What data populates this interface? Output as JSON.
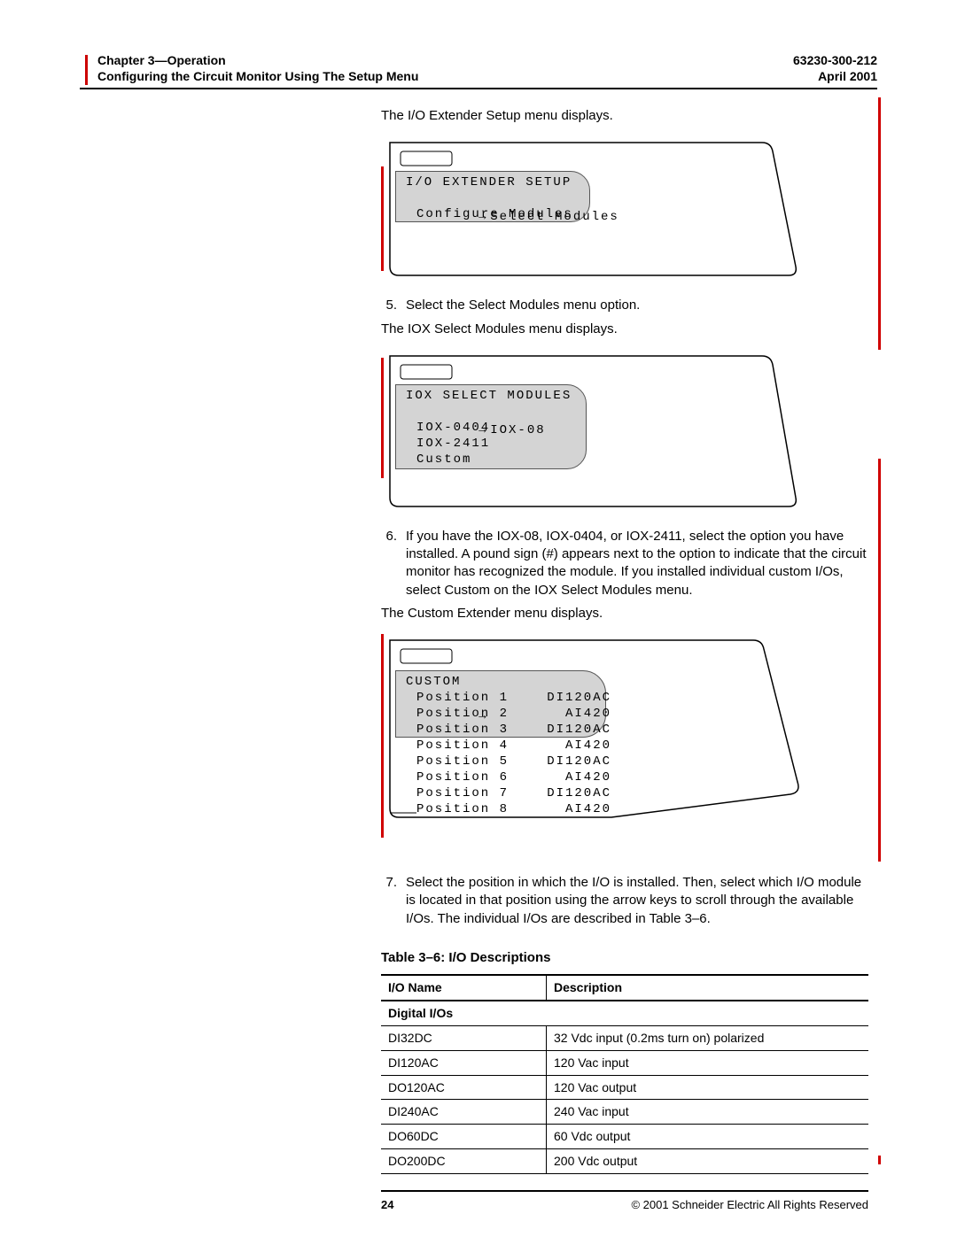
{
  "header": {
    "chapter": "Chapter 3—Operation",
    "subtitle": "Configuring the Circuit Monitor Using The Setup Menu",
    "docnum": "63230-300-212",
    "date": "April 2001"
  },
  "body": {
    "intro1": "The I/O Extender Setup menu displays.",
    "screen1": {
      "title": "I/O EXTENDER SETUP",
      "opt1": "Select Modules",
      "opt2": "Configure Modules"
    },
    "step5_num": "5.",
    "step5_txt": "Select the Select Modules menu option.",
    "step5_sub": "The IOX Select Modules menu displays.",
    "screen2": {
      "title": "IOX SELECT MODULES",
      "opt1": "IOX-08",
      "opt2": "IOX-0404",
      "opt3": "IOX-2411",
      "opt4": "Custom"
    },
    "step6_num": "6.",
    "step6_txt": "If you have the IOX-08, IOX-0404, or IOX-2411, select the option you have installed. A pound sign (#) appears next to the option to indicate that the circuit monitor has recognized the module. If you installed individual custom I/Os, select Custom on the IOX Select Modules menu.",
    "step6_sub": "The Custom Extender menu displays.",
    "screen3": {
      "title": "CUSTOM",
      "rows": [
        {
          "k": "Position 1",
          "v": "DI120AC"
        },
        {
          "k": "Position 2",
          "v": "AI420"
        },
        {
          "k": "Position 3",
          "v": "DI120AC"
        },
        {
          "k": "Position 4",
          "v": "AI420"
        },
        {
          "k": "Position 5",
          "v": "DI120AC"
        },
        {
          "k": "Position 6",
          "v": "AI420"
        },
        {
          "k": "Position 7",
          "v": "DI120AC"
        },
        {
          "k": "Position 8",
          "v": "AI420"
        }
      ]
    },
    "step7_num": "7.",
    "step7_txt": "Select the position in which the I/O is installed. Then, select which I/O module is located in that position using the arrow keys to scroll through the available I/Os. The individual I/Os are described in Table 3–6."
  },
  "table": {
    "title": "Table 3–6:   I/O Descriptions",
    "head_name": "I/O Name",
    "head_desc": "Description",
    "section": "Digital I/Os",
    "rows": [
      {
        "n": "DI32DC",
        "d": "32 Vdc input (0.2ms turn on) polarized"
      },
      {
        "n": "DI120AC",
        "d": "120 Vac input"
      },
      {
        "n": "DO120AC",
        "d": "120 Vac output"
      },
      {
        "n": "DI240AC",
        "d": "240 Vac input"
      },
      {
        "n": "DO60DC",
        "d": "60 Vdc output"
      },
      {
        "n": "DO200DC",
        "d": "200 Vdc output"
      }
    ]
  },
  "footer": {
    "page": "24",
    "copyright": "© 2001 Schneider Electric  All Rights Reserved"
  }
}
